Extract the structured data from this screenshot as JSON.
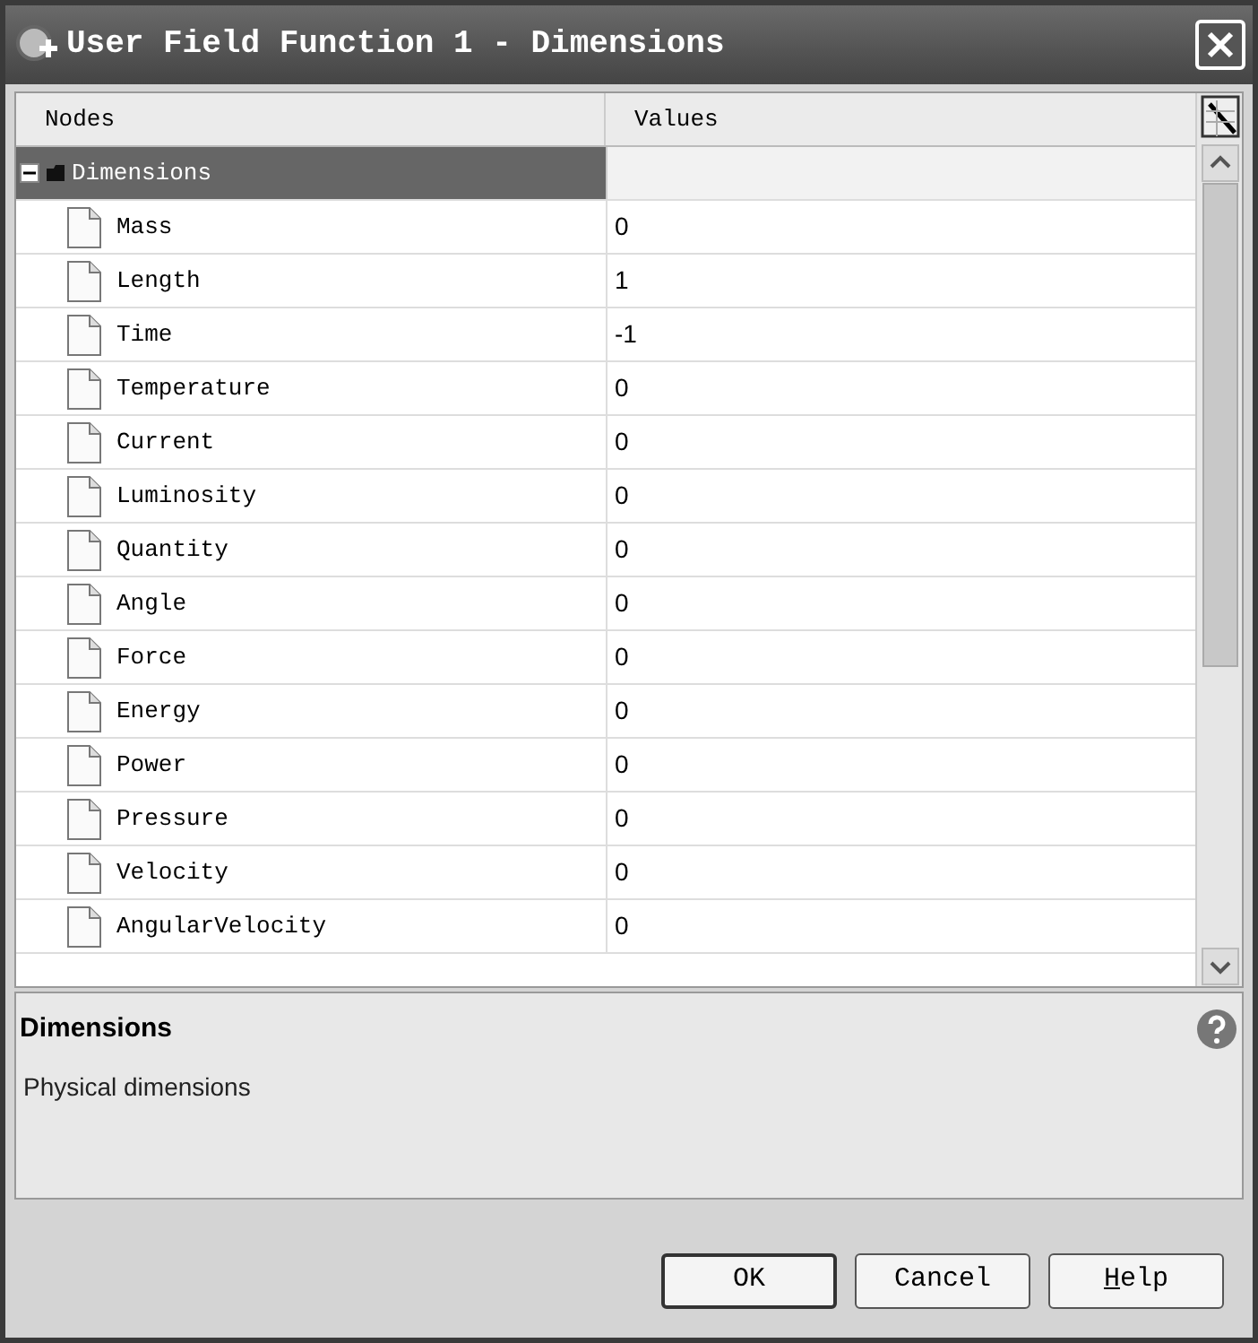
{
  "window": {
    "title": "User Field Function 1 - Dimensions"
  },
  "table": {
    "columns": [
      "Nodes",
      "Values"
    ],
    "root": {
      "label": "Dimensions",
      "expanded": true,
      "selected": true,
      "children": [
        {
          "label": "Mass",
          "value": "0"
        },
        {
          "label": "Length",
          "value": "1"
        },
        {
          "label": "Time",
          "value": "-1"
        },
        {
          "label": "Temperature",
          "value": "0"
        },
        {
          "label": "Current",
          "value": "0"
        },
        {
          "label": "Luminosity",
          "value": "0"
        },
        {
          "label": "Quantity",
          "value": "0"
        },
        {
          "label": "Angle",
          "value": "0"
        },
        {
          "label": "Force",
          "value": "0"
        },
        {
          "label": "Energy",
          "value": "0"
        },
        {
          "label": "Power",
          "value": "0"
        },
        {
          "label": "Pressure",
          "value": "0"
        },
        {
          "label": "Velocity",
          "value": "0"
        },
        {
          "label": "AngularVelocity",
          "value": "0"
        }
      ]
    }
  },
  "description": {
    "title": "Dimensions",
    "text": "Physical dimensions"
  },
  "buttons": [
    {
      "label": "OK",
      "default": true
    },
    {
      "label": "Cancel",
      "default": false
    },
    {
      "label": "Help",
      "default": false,
      "first_letter_underlined": true
    }
  ]
}
